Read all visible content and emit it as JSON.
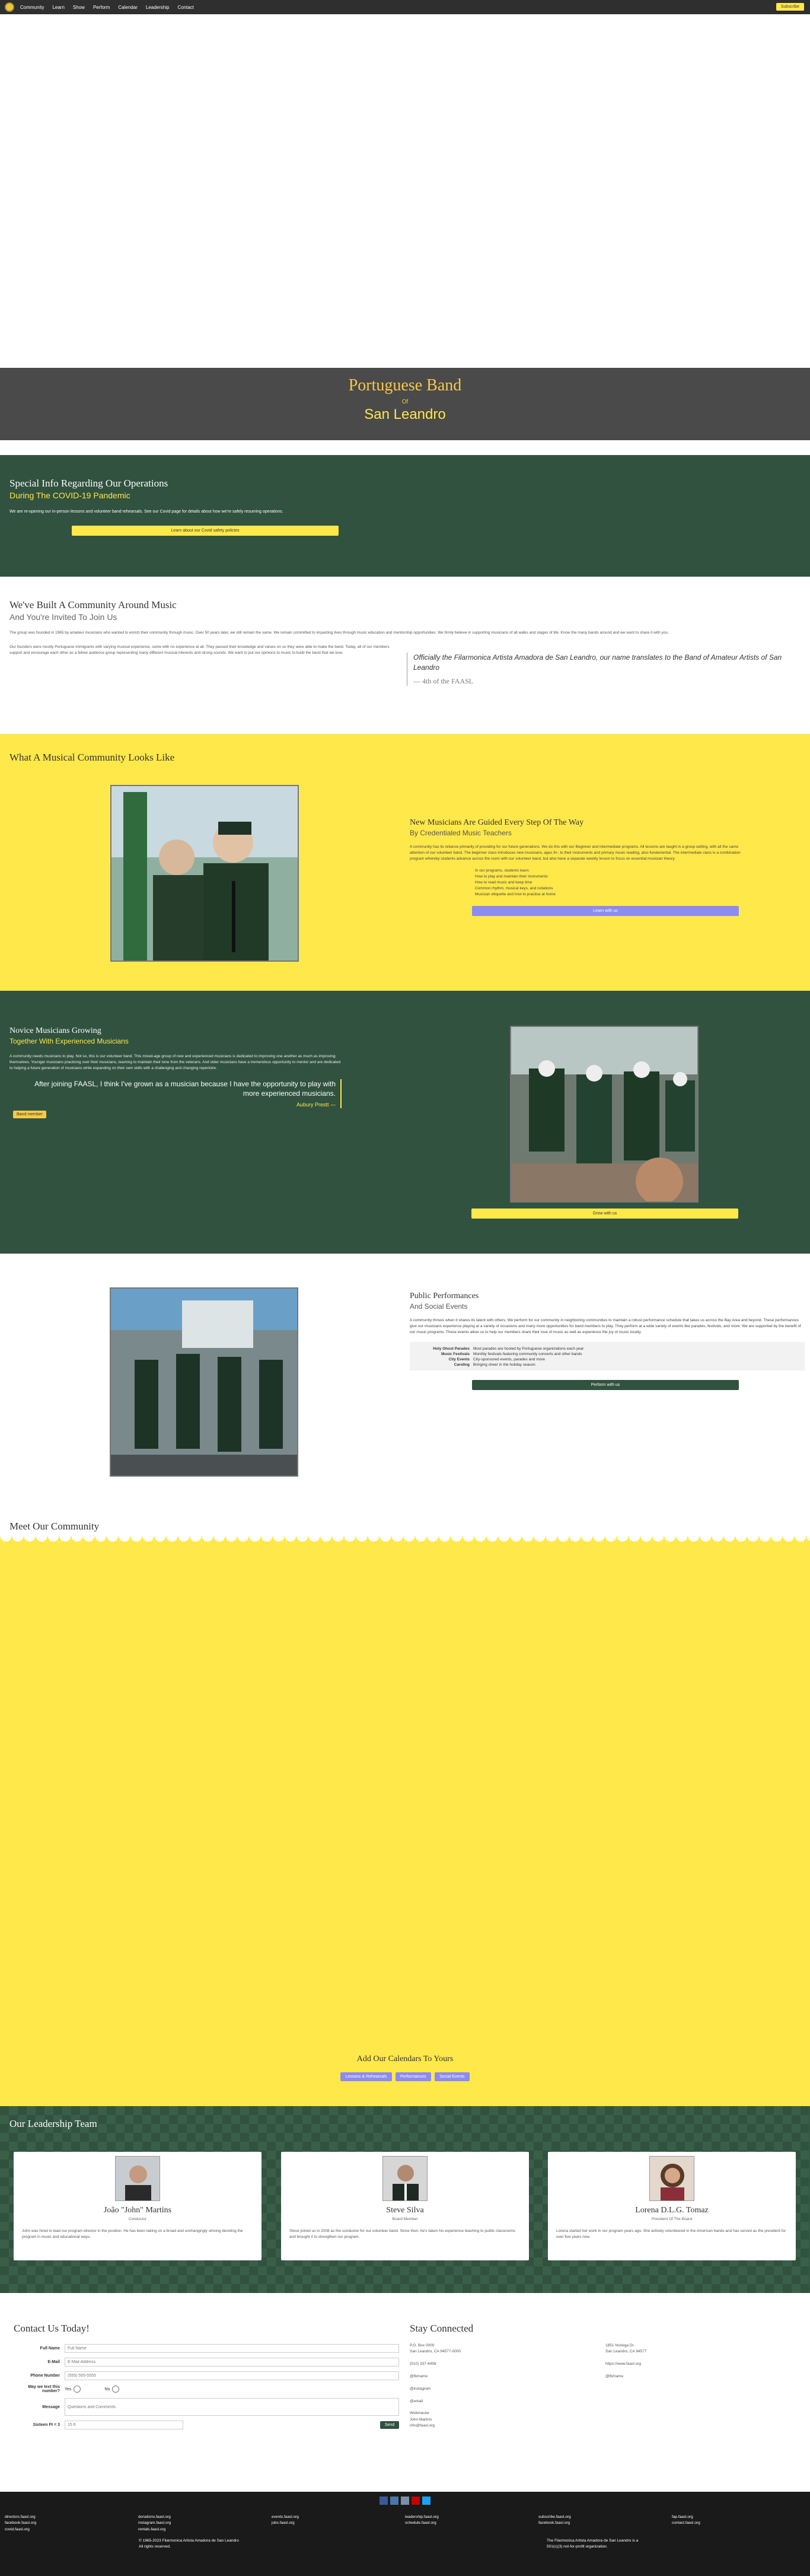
{
  "nav": {
    "items": [
      "Community",
      "Learn",
      "Show",
      "Perform",
      "Calendar",
      "Leadership",
      "Contact"
    ],
    "cta": "Subscribe"
  },
  "banner": {
    "line1": "Portuguese Band",
    "line2": "Of",
    "line3": "San Leandro"
  },
  "covid": {
    "title": "Special Info Regarding Our Operations",
    "subtitle": "During The COVID-19 Pandemic",
    "text": "We are re-opening our in-person lessons and volunteer band rehearsals. See our Covid page for details about how we're safely resuming operations.",
    "button": "Learn about our Covid safety policies"
  },
  "built": {
    "title": "We've Built A Community Around Music",
    "subtitle": "And You're Invited To Join Us",
    "p1": "The group was founded in 1965 by amateur musicians who wanted to enrich their community through music. Over 50 years later, we still remain the same. We remain committed to impacting lives through music education and mentorship opportunities. We firmly believe in supporting musicians of all walks and stages of life. Know the many bands around and we want to share it with you.",
    "p2": "Our founders were mostly Portuguese immigrants with varying musical experience, some with no experience at all. They passed their knowledge and values on so they were able to make the band. Today, all of our members support and encourage each other as a fellow audience group representing many different musical interests and strong sounds. We want to put our opinions to music to build the band that we love.",
    "quote": "Officially the Filarmonica Artista Amadora de San Leandro, our name translates to the Band of Amateur Artists of San Leandro",
    "quote_by": "— 4th of the FAASL"
  },
  "community": {
    "section_title": "What A Musical Community Looks Like",
    "title": "New Musicians Are Guided Every Step Of The Way",
    "subtitle": "By Credentialed Music Teachers",
    "text": "A community has its reliance primarily of providing for our future generations. We do this with our Beginner and intermediate programs. All lessons are taught in a group setting, with all the same attention of our volunteer band. The beginner class introduces new musicians, ages 8+, to their instruments and primary music reading, also fundamental. The intermediate class is a combination program whereby students advance across the room with our volunteer band, but also have a separate weekly lesson to focus on essential musician theory.",
    "bullets_intro": "In our programs, students learn:",
    "bullets": [
      "How to play and maintain their instruments",
      "How to read music and keep time",
      "Common rhythm, musical keys, and notations",
      "Musician etiquette and how to practice at home"
    ],
    "button": "Learn with us"
  },
  "novice": {
    "title": "Novice Musicians Growing",
    "subtitle": "Together With Experienced Musicians",
    "text": "A community needs musicians to play. Not so, this is our volunteer band. This mixed-age group of new and experienced musicians is dedicated to improving one another as much as improving themselves. Younger musicians practicing over their musicians, learning to maintain their tone from the veterans. And older musicians have a tremendous opportunity to mentor and are dedicated to helping a future generation of musicians while expanding on their own skills with a challenging and changing repertoire.",
    "quote": "After joining FAASL, I think I've grown as a musician because I have the opportunity to play with more experienced musicians.",
    "quote_by": "Aubury Prestt —",
    "tag": "Band member",
    "button": "Grow with us"
  },
  "performances": {
    "title": "Public Performances",
    "subtitle": "And Social Events",
    "text": "A community thrives when it shares its talent with others. We perform for our community in neighboring communities to maintain a robust performance schedule that takes us across the Bay Area and beyond. These performances give our musicians experience playing at a variety of occasions and many more opportunities for band members to play. They perform at a wide variety of events like parades, festivals, and more. We are supported by the benefit of our music programs. These events allow us to help our members share their love of music as well as experience the joy of music locally.",
    "rows": [
      {
        "label": "Holy Ghost Parades",
        "value": "Most parades are hosted by Portuguese organizations each year"
      },
      {
        "label": "Music Festivals",
        "value": "Monthly festivals featuring community concerts and other bands"
      },
      {
        "label": "City Events",
        "value": "City-sponsored events, parades and more"
      },
      {
        "label": "Caroling",
        "value": "Bringing cheer in the holiday season"
      }
    ],
    "button": "Perform with us"
  },
  "meet": {
    "title": "Meet Our Community",
    "cal_title": "Add Our Calendars To Yours",
    "cal_buttons": [
      "Lessons & Rehearsals",
      "Performances",
      "Social Events"
    ]
  },
  "leadership": {
    "title": "Our Leadership Team",
    "people": [
      {
        "name": "João \"John\" Martins",
        "role": "Conductor",
        "bio": "John was hired to lead our program director in the position. He has been taking on a broad and unchangingly striving devoting the program in music and educational ways."
      },
      {
        "name": "Steve Silva",
        "role": "Board Member",
        "bio": "Steve joined us in 2008 as the conductor for our volunteer band. Since then, he's taken his experience teaching to public classrooms and brought it to strengthen our program."
      },
      {
        "name": "Lorena D.L.G. Tomaz",
        "role": "President Of The Board",
        "bio": "Lorena started her work in our program years ago. She actively volunteered in the American bands and has served as the president for over five years now."
      }
    ]
  },
  "contact": {
    "title": "Contact Us Today!",
    "fields": [
      {
        "label": "Full Name",
        "placeholder": "Full Name"
      },
      {
        "label": "E-Mail",
        "placeholder": "E-Mail Address"
      },
      {
        "label": "Phone Number",
        "placeholder": "(555) 555-5555"
      }
    ],
    "contact_label": "May we text this number?",
    "yes": "Yes",
    "no": "No",
    "message_label": "Message",
    "message_placeholder": "Questions and Comments",
    "captcha_label": "Sixteen Ft = 3",
    "captcha_placeholder": "15 ft",
    "send": "Send"
  },
  "stay": {
    "title": "Stay Connected",
    "col1": [
      "P.O. Box 0000",
      "San Leandro, CA 94577-0000",
      "",
      "(510) 337-4458",
      "",
      "@fb/name",
      "",
      "@instagram",
      "",
      "@email",
      "",
      "Webmaster",
      "John Martins",
      "info@faasl.org"
    ],
    "col2": [
      "1851 Noriega Dr.",
      "San Leandro, CA 94577",
      "",
      "https://www.faasl.org",
      "",
      "@fb/name"
    ]
  },
  "social_colors": [
    "#3b5998",
    "#4a76a8",
    "#7b8fa8",
    "#c40000",
    "#1da1f2"
  ],
  "footer": {
    "cols": [
      [
        "directors.faasl.org",
        "facebook.faasl.org",
        "covid.faasl.org"
      ],
      [
        "donations.faasl.org",
        "instagram.faasl.org",
        "rentals.faasl.org"
      ],
      [
        "events.faasl.org",
        "jobs.faasl.org"
      ],
      [
        "leadership.faasl.org",
        "schedule.faasl.org"
      ],
      [
        "subscribe.faasl.org",
        "facebook.faasl.org"
      ],
      [
        "fap.faasl.org",
        "contact.faasl.org"
      ]
    ],
    "copyright": "© 1965-2023 Filarmonica Artista Amadora de San Leandro",
    "rights": "All rights reserved.",
    "nfp1": "The Filarmonica Artista Amadora de San Leandro is a",
    "nfp2": "501(c)(3) not-for-profit organization."
  }
}
